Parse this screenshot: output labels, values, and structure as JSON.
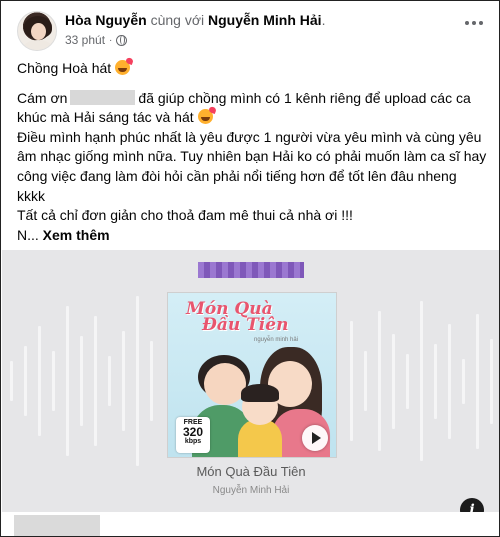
{
  "post": {
    "author": "Hòa Nguyễn",
    "with_text": "cùng với",
    "tagged_user": "Nguyễn Minh Hải",
    "tagged_suffix": ".",
    "time": "33 phút",
    "separator": "·",
    "privacy_icon": "globe-icon",
    "more_icon": "more-horizontal-icon"
  },
  "text": {
    "line1": "Chồng Hoà hát",
    "p2_start": "Cám ơn",
    "p2_end": "đã giúp chồng mình có 1 kênh riêng để upload các ca khúc mà Hải sáng tác và hát",
    "p3": "Điều mình hạnh phúc nhất là yêu được 1 người vừa yêu mình và cùng yêu âm nhạc giống mình nữa. Tuy nhiên bạn Hải ko có phải muốn làm ca sĩ hay công việc đang làm đòi hỏi cần phải nổi tiếng hơn để tốt lên đâu nheng kkkk",
    "p4": "Tất cả chỉ đơn giản cho thoả đam mê thui cả nhà ơi !!!",
    "truncated": "N...",
    "see_more": "Xem thêm",
    "emoji_icon": "smiling-face-with-hearts-icon"
  },
  "media": {
    "album_title_line1": "Món Quà",
    "album_title_line2": "Đầu Tiên",
    "album_subtitle": "nguyễn minh hải",
    "badge_free": "FREE",
    "badge_bitrate": "320",
    "badge_unit": "kbps",
    "song_title": "Món Quà Đầu Tiên",
    "artist": "Nguyễn Minh Hải",
    "info_label": "i",
    "colors": {
      "background": "#e6e6e8",
      "redacted_title": "#8a60c9"
    }
  }
}
